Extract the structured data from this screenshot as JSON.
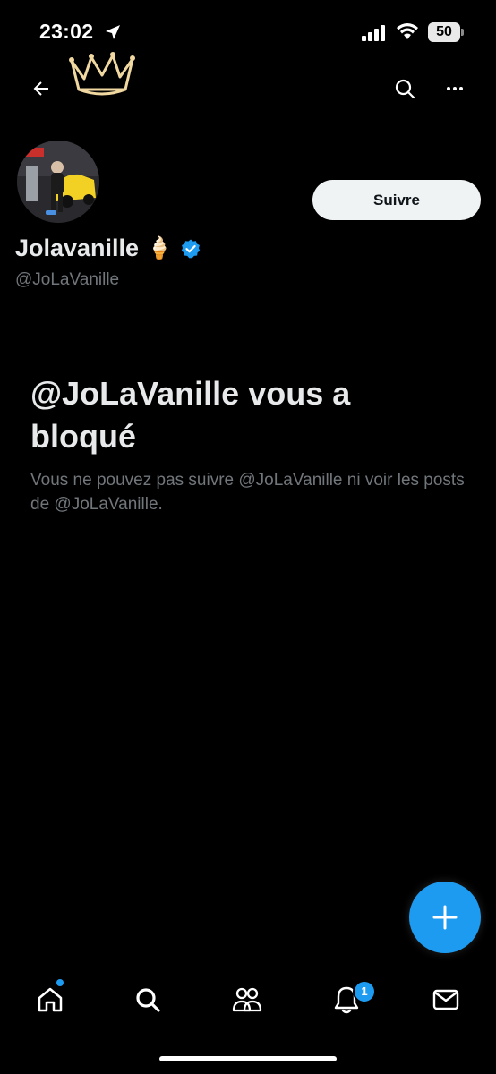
{
  "status_bar": {
    "time": "23:02",
    "battery": "50"
  },
  "header": {
    "back_icon": "back-arrow-icon",
    "banner_icon": "crown-icon",
    "search_icon": "search-icon",
    "more_icon": "more-icon"
  },
  "profile": {
    "display_name": "Jolavanille",
    "emoji": "🍦",
    "handle": "@JoLaVanille",
    "follow_label": "Suivre",
    "verified_color": "#1d9bf0"
  },
  "blocked": {
    "title": "@JoLaVanille vous a bloqué",
    "description": "Vous ne pouvez pas suivre @JoLaVanille ni voir les posts de @JoLaVanille."
  },
  "fab": {
    "icon": "plus-icon",
    "color": "#1d9bf0"
  },
  "bottom_nav": {
    "items": [
      "home-icon",
      "search-icon",
      "communities-icon",
      "notifications-icon",
      "messages-icon"
    ],
    "notification_count": "1"
  }
}
